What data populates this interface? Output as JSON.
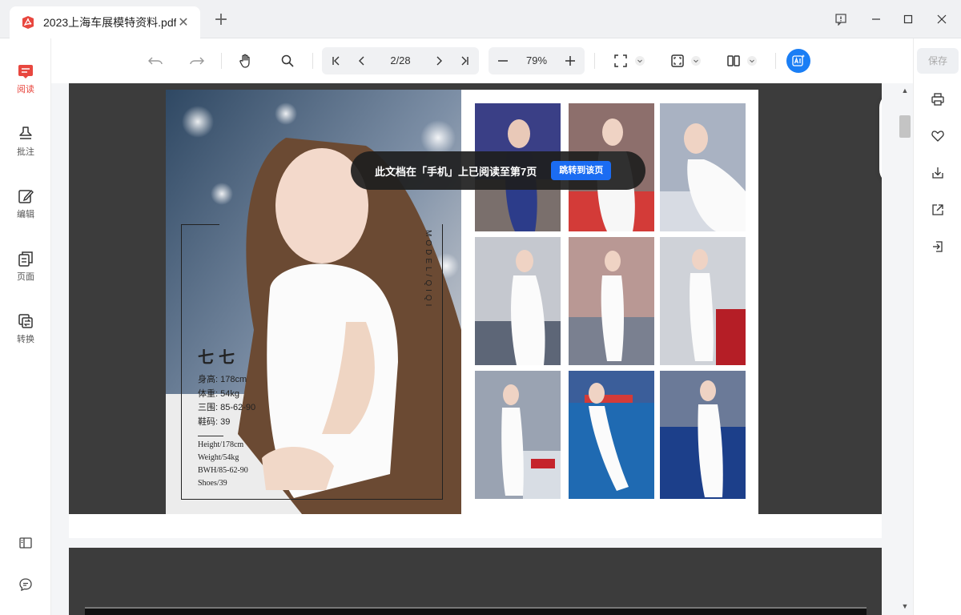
{
  "tab": {
    "title": "2023上海车展模特资料.pdf",
    "close": "✕"
  },
  "new_tab": "+",
  "toolbar": {
    "page_display": "2/28",
    "zoom": "79%"
  },
  "sidebar": {
    "items": [
      {
        "label": "阅读"
      },
      {
        "label": "批注"
      },
      {
        "label": "编辑"
      },
      {
        "label": "页面"
      },
      {
        "label": "转换"
      }
    ]
  },
  "right": {
    "save_label": "保存"
  },
  "banner": {
    "text": "此文档在「手机」上已阅读至第7页",
    "button": "跳转到该页"
  },
  "model": {
    "name": "七七",
    "vertical_label": "MODEL/QIQI",
    "stats_cn": [
      "身高: 178cm",
      "体重: 54kg",
      "三围: 85-62-90",
      "鞋码: 39"
    ],
    "stats_en": [
      "Height/178cm",
      "Weight/54kg",
      "BWH/85-62-90",
      "Shoes/39"
    ]
  },
  "colors": {
    "accent_red": "#e8473f",
    "brand_blue": "#1a7ef5",
    "jump_blue": "#1b6cf2",
    "page_dark": "#3c3c3c"
  }
}
